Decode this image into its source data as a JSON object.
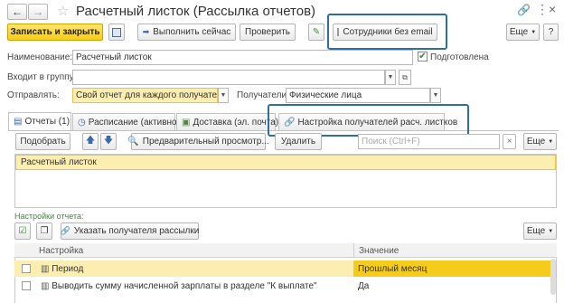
{
  "window": {
    "title": "Расчетный листок (Рассылка отчетов)",
    "back_icon": "arrow-left-icon",
    "forward_icon": "arrow-right-icon",
    "star_icon": "star-icon",
    "link_icon": "link-icon",
    "menu_icon": "more-icon",
    "close_icon": "close-icon"
  },
  "toolbar": {
    "save_close": "Записать и закрыть",
    "run_now": "Выполнить сейчас",
    "check": "Проверить",
    "employees_no_email": "Сотрудники без email",
    "more": "Еще",
    "help": "?"
  },
  "form": {
    "name_label": "Наименование:",
    "name_value": "Расчетный листок",
    "ready_label": "Подготовлена",
    "ready_checked": true,
    "group_label": "Входит в группу:",
    "group_value": "",
    "send_label": "Отправлять:",
    "send_value": "Свой отчет для каждого получателя",
    "recipients_label": "Получатели:",
    "recipients_value": "Физические лица"
  },
  "tabs": [
    {
      "label": "Отчеты (1)"
    },
    {
      "label": "Расписание (активно)"
    },
    {
      "label": "Доставка (эл. почта)"
    },
    {
      "label": "Настройка получателей расч. листков"
    }
  ],
  "reports_toolbar": {
    "pick": "Подобрать",
    "preview": "Предварительный просмотр...",
    "delete": "Удалить",
    "search_placeholder": "Поиск (Ctrl+F)",
    "more": "Еще"
  },
  "reports_list": [
    {
      "name": "Расчетный листок"
    }
  ],
  "settings": {
    "label": "Настройки отчета:",
    "specify_recipient": "Указать получателя рассылки",
    "more": "Еще",
    "columns": {
      "setting": "Настройка",
      "value": "Значение"
    },
    "rows": [
      {
        "setting": "Период",
        "value": "Прошлый месяц"
      },
      {
        "setting": "Выводить сумму начисленной зарплаты в разделе \"К выплате\"",
        "value": "Да"
      }
    ]
  },
  "colors": {
    "accent_yellow": "#f5cb1c",
    "selection": "#fbeeb0",
    "highlight_frame": "#2d6ea5",
    "section_green": "#3b8a3b"
  }
}
